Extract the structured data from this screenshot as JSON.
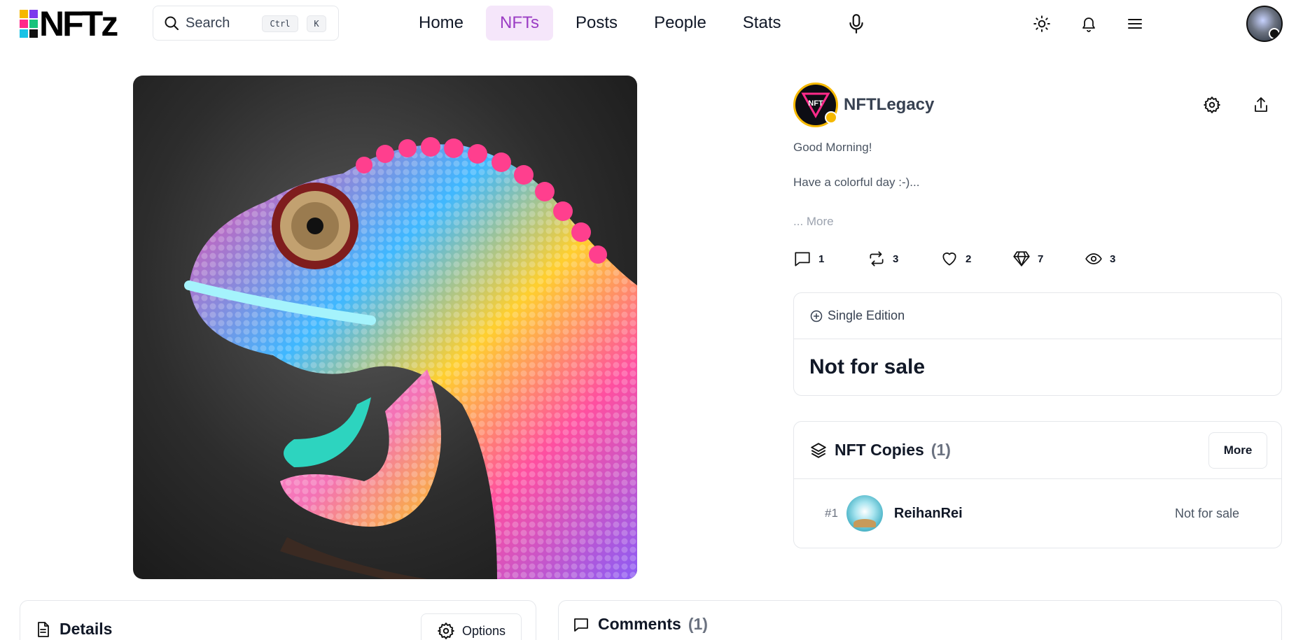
{
  "header": {
    "logo_text": "NFTz",
    "logo_colors": [
      "#f5b800",
      "#ff2a8a",
      "#19c3e6",
      "#7c3aed",
      "#19c37d",
      "#111111"
    ],
    "search": {
      "placeholder": "Search",
      "shortcut_ctrl": "Ctrl",
      "shortcut_key": "K"
    },
    "nav": [
      {
        "label": "Home",
        "active": false
      },
      {
        "label": "NFTs",
        "active": true
      },
      {
        "label": "Posts",
        "active": false
      },
      {
        "label": "People",
        "active": false
      },
      {
        "label": "Stats",
        "active": false
      }
    ],
    "icons": [
      "microphone-icon",
      "sun-icon",
      "bell-icon",
      "menu-icon",
      "user-avatar"
    ]
  },
  "nft": {
    "image_subject": "rainbow-chameleon-artwork"
  },
  "creator": {
    "name": "NFTLegacy",
    "avatar_text": "NFT",
    "badge_color": "#f5b800"
  },
  "description": {
    "line1": "Good Morning!",
    "line2": "Have a colorful day :-)...",
    "more": "... More"
  },
  "stats": {
    "comments": "1",
    "reposts": "3",
    "likes": "2",
    "gems": "7",
    "views": "3"
  },
  "edition": {
    "label": "Single Edition",
    "sale_status": "Not for sale"
  },
  "copies": {
    "title": "NFT Copies",
    "count": "(1)",
    "more_label": "More",
    "items": [
      {
        "number": "#1",
        "owner": "ReihanRei",
        "status": "Not for sale"
      }
    ]
  },
  "details": {
    "title": "Details",
    "options_label": "Options"
  },
  "comments": {
    "title": "Comments",
    "count": "(1)"
  },
  "colors": {
    "accent": "#9b3dc4",
    "accent_bg": "#f5e6fa",
    "border": "#e5e7eb"
  }
}
